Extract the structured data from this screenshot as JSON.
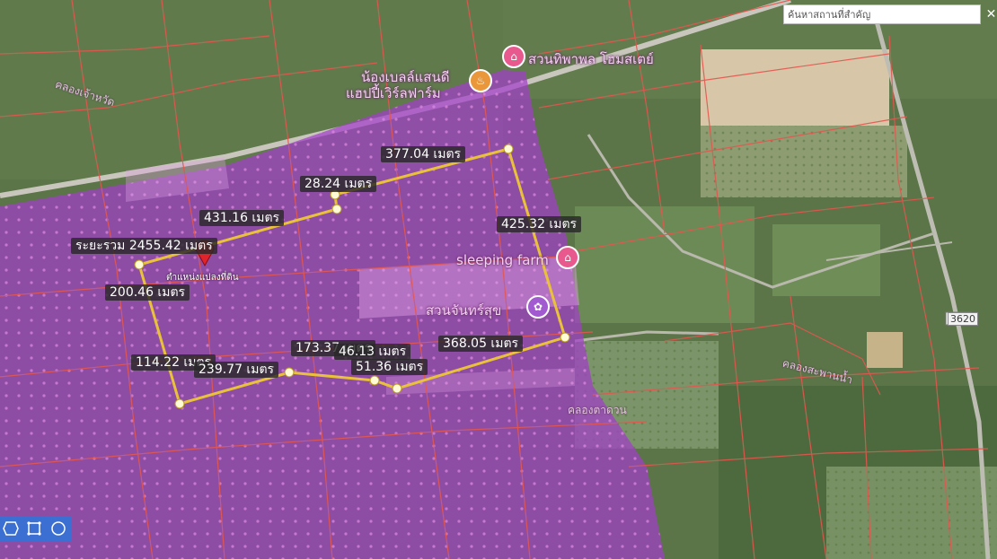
{
  "search": {
    "placeholder": "ค้นหาสถานที่สำคัญ",
    "close_label": "✕"
  },
  "measure": {
    "total_label": "ระยะรวม 2455.42 เมตร",
    "marker_caption": "ตำแหน่งแปลงที่ดิน",
    "segments": [
      "377.04 เมตร",
      "28.24 เมตร",
      "431.16 เมตร",
      "425.32 เมตร",
      "200.46 เมตร",
      "114.22 เมตร",
      "239.77 เมตร",
      "173.37 เมตร",
      "46.13 เมตร",
      "51.36 เมตร",
      "368.05 เมตร"
    ]
  },
  "places": {
    "poi_1": "สวนทิพาพล โฮมสเตย์",
    "poi_2": "น้องเบลล์แสนดี",
    "poi_3": "แฮปปี้เวิร์ลฟาร์ม",
    "poi_4": "sleeping farm",
    "poi_5": "สวนจันทร์สุข"
  },
  "map_labels": {
    "canal_1": "คลองเจ้าหวัด",
    "canal_2": "คลองสะพานน้ำ",
    "canal_3": "คลองตาดวน",
    "road_shield": "3620"
  },
  "toolbar": {
    "tools": [
      "polygon-icon",
      "rectangle-icon",
      "circle-icon"
    ]
  },
  "colors": {
    "zone": "#a23fc9",
    "route": "#e9c23a",
    "parcel_lines": "#e4574f",
    "toolbar": "#3b6fd1"
  }
}
